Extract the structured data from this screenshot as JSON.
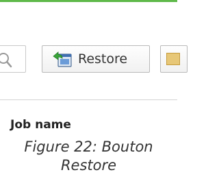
{
  "toolbar": {
    "restore_label": "Restore",
    "search_icon": "search-icon",
    "restore_icon": "restore-icon",
    "next_icon": "folder-icon"
  },
  "table": {
    "column_header": "Job name"
  },
  "caption": {
    "text": "Figure 22: Bouton Restore"
  },
  "colors": {
    "accent": "#5fb94a",
    "border": "#b9b9b9",
    "text": "#333333"
  }
}
